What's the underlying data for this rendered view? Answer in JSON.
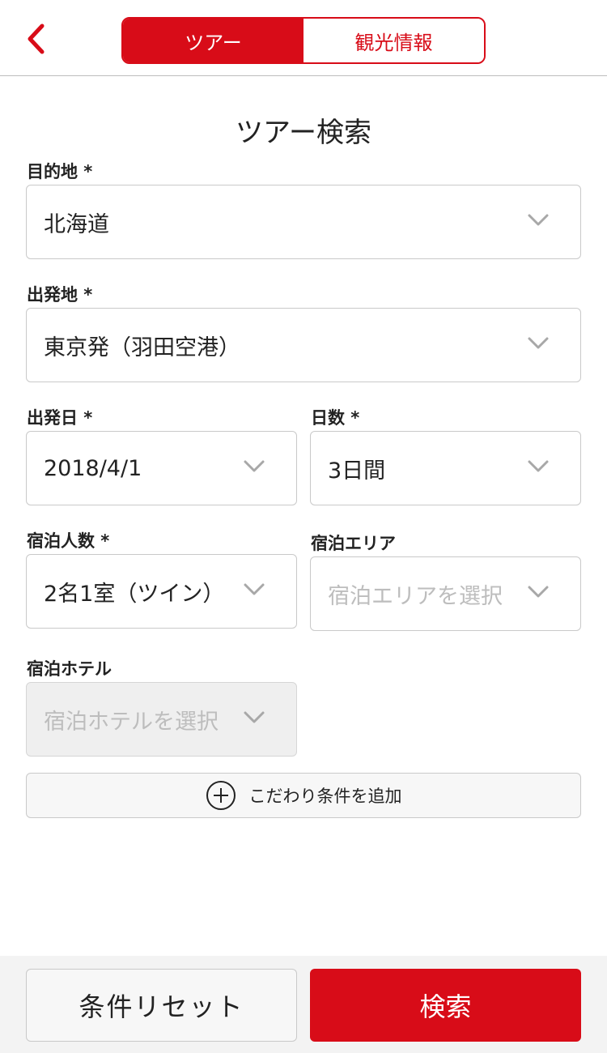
{
  "header": {
    "tabs": [
      {
        "label": "ツアー",
        "active": true
      },
      {
        "label": "観光情報",
        "active": false
      }
    ]
  },
  "page_title": "ツアー検索",
  "fields": {
    "destination": {
      "label": "目的地 *",
      "value": "北海道"
    },
    "departure_place": {
      "label": "出発地 *",
      "value": "東京発（羽田空港）"
    },
    "departure_date": {
      "label": "出発日 *",
      "value": "2018/4/1"
    },
    "days": {
      "label": "日数 *",
      "value": "3日間"
    },
    "guests": {
      "label": "宿泊人数 *",
      "value": "2名1室（ツイン）"
    },
    "stay_area": {
      "label": "宿泊エリア",
      "placeholder": "宿泊エリアを選択"
    },
    "hotel": {
      "label": "宿泊ホテル",
      "placeholder": "宿泊ホテルを選択",
      "disabled": true
    }
  },
  "add_condition": {
    "label": "こだわり条件を追加"
  },
  "footer": {
    "reset_label": "条件リセット",
    "search_label": "検索"
  },
  "colors": {
    "accent": "#d80c18",
    "placeholder": "#bdbdbd",
    "chevron": "#a8a8a8"
  }
}
